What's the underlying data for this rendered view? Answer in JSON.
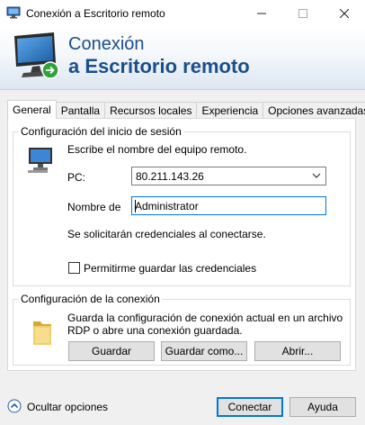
{
  "window": {
    "title": "Conexión a Escritorio remoto",
    "icon": "remote-desktop-icon",
    "minimize_glyph": "—",
    "maximize_glyph": "☐",
    "close_glyph": "✕"
  },
  "banner": {
    "line1": "Conexión",
    "line2": "a Escritorio remoto",
    "color": "#1a4f8a"
  },
  "tabs": [
    {
      "label": "General",
      "active": true
    },
    {
      "label": "Pantalla",
      "active": false
    },
    {
      "label": "Recursos locales",
      "active": false
    },
    {
      "label": "Experiencia",
      "active": false
    },
    {
      "label": "Opciones avanzadas",
      "active": false
    }
  ],
  "logon_group": {
    "title": "Configuración del inicio de sesión",
    "instruction": "Escribe el nombre del equipo remoto.",
    "pc_label": "PC:",
    "pc_value": "80.211.143.26",
    "user_label": "Nombre de",
    "user_value": "Administrator",
    "credentials_note": "Se solicitarán credenciales al conectarse.",
    "remember_label": "Permitirme guardar las credenciales",
    "remember_checked": false
  },
  "connection_group": {
    "title": "Configuración de la conexión",
    "description_line1": "Guarda la configuración de conexión actual en un archivo",
    "description_line2": "RDP o abre una conexión guardada.",
    "save_label": "Guardar",
    "save_as_label": "Guardar como...",
    "open_label": "Abrir..."
  },
  "footer": {
    "hide_options_label": "Ocultar opciones",
    "connect_label": "Conectar",
    "help_label": "Ayuda"
  },
  "colors": {
    "accent": "#0078d7",
    "window_bg": "#f0f0f0"
  }
}
